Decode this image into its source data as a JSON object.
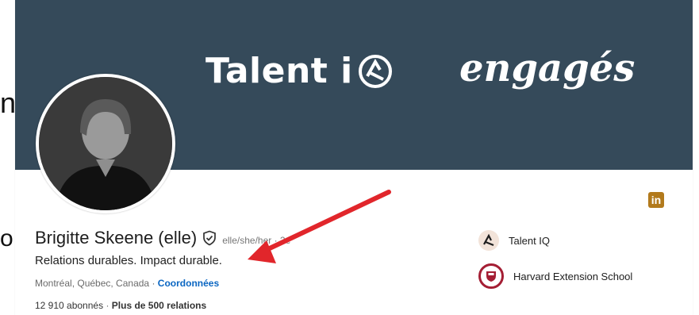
{
  "background_fragments": {
    "left_top": "n",
    "left_bottom": "o"
  },
  "banner": {
    "brand": "Talent i",
    "tagline": "engagés",
    "background_color": "#354a5a"
  },
  "profile": {
    "name": "Brigitte Skeene (elle)",
    "pronoun_meta": "elle/she/her · 2e",
    "headline": "Relations durables. Impact durable.",
    "location": "Montréal, Québec, Canada",
    "separator": "·",
    "contact_link": "Coordonnées",
    "followers": "12 910 abonnés",
    "relations": "Plus de 500 relations"
  },
  "linkedin_badge": {
    "label": "in",
    "color": "#b27a1c"
  },
  "organizations": [
    {
      "name": "Talent IQ",
      "icon": "talent-iq-logo-icon"
    },
    {
      "name": "Harvard Extension School",
      "icon": "harvard-shield-icon"
    }
  ],
  "annotation": {
    "arrow_color": "#e1262b"
  },
  "colors": {
    "link": "#0a66c2",
    "text_primary": "#1d1d1d",
    "text_muted": "#6b6b6b"
  }
}
